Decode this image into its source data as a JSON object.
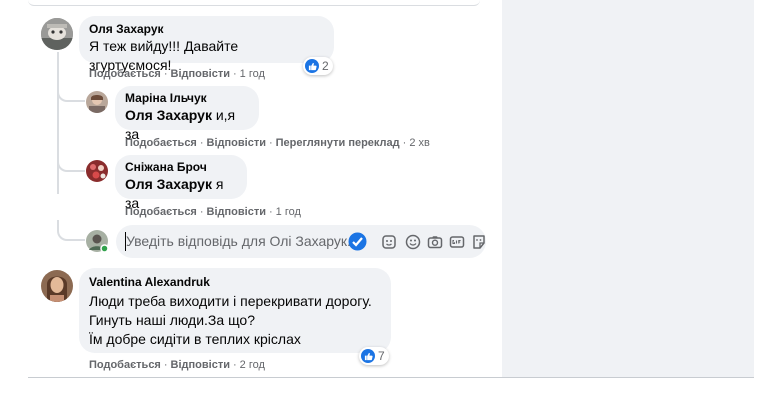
{
  "comments": [
    {
      "author": "Оля Захарук",
      "text": "Я теж вийду!!! Давайте згуртуємося!",
      "actions": {
        "like": "Подобається",
        "reply": "Відповісти",
        "time": "1 год"
      },
      "reactions": {
        "icon": "like-icon",
        "count": "2"
      },
      "replies": [
        {
          "author": "Маріна Ільчук",
          "mention": "Оля Захарук",
          "text": " и,я за",
          "actions": {
            "like": "Подобається",
            "reply": "Відповісти",
            "translate": "Переглянути переклад",
            "time": "2 хв"
          }
        },
        {
          "author": "Сніжана Броч",
          "mention": "Оля Захарук",
          "text": " я за",
          "actions": {
            "like": "Подобається",
            "reply": "Відповісти",
            "time": "1 год"
          }
        }
      ],
      "reply_box": {
        "placeholder": "Уведіть відповідь для Олі Захарук."
      }
    },
    {
      "author": "Valentina Alexandruk",
      "lines": [
        "Люди треба виходити і перекривати дорогу.",
        "Гинуть наші люди.За що?",
        "Їм добре сидіти в теплих кріслах"
      ],
      "actions": {
        "like": "Подобається",
        "reply": "Відповісти",
        "time": "2 год"
      },
      "reactions": {
        "icon": "like-icon",
        "count": "7"
      }
    }
  ],
  "colors": {
    "like_blue": "#1b74e4",
    "bubble": "#f0f2f5",
    "meta": "#65676b",
    "side_panel": "#f0f2f5"
  }
}
